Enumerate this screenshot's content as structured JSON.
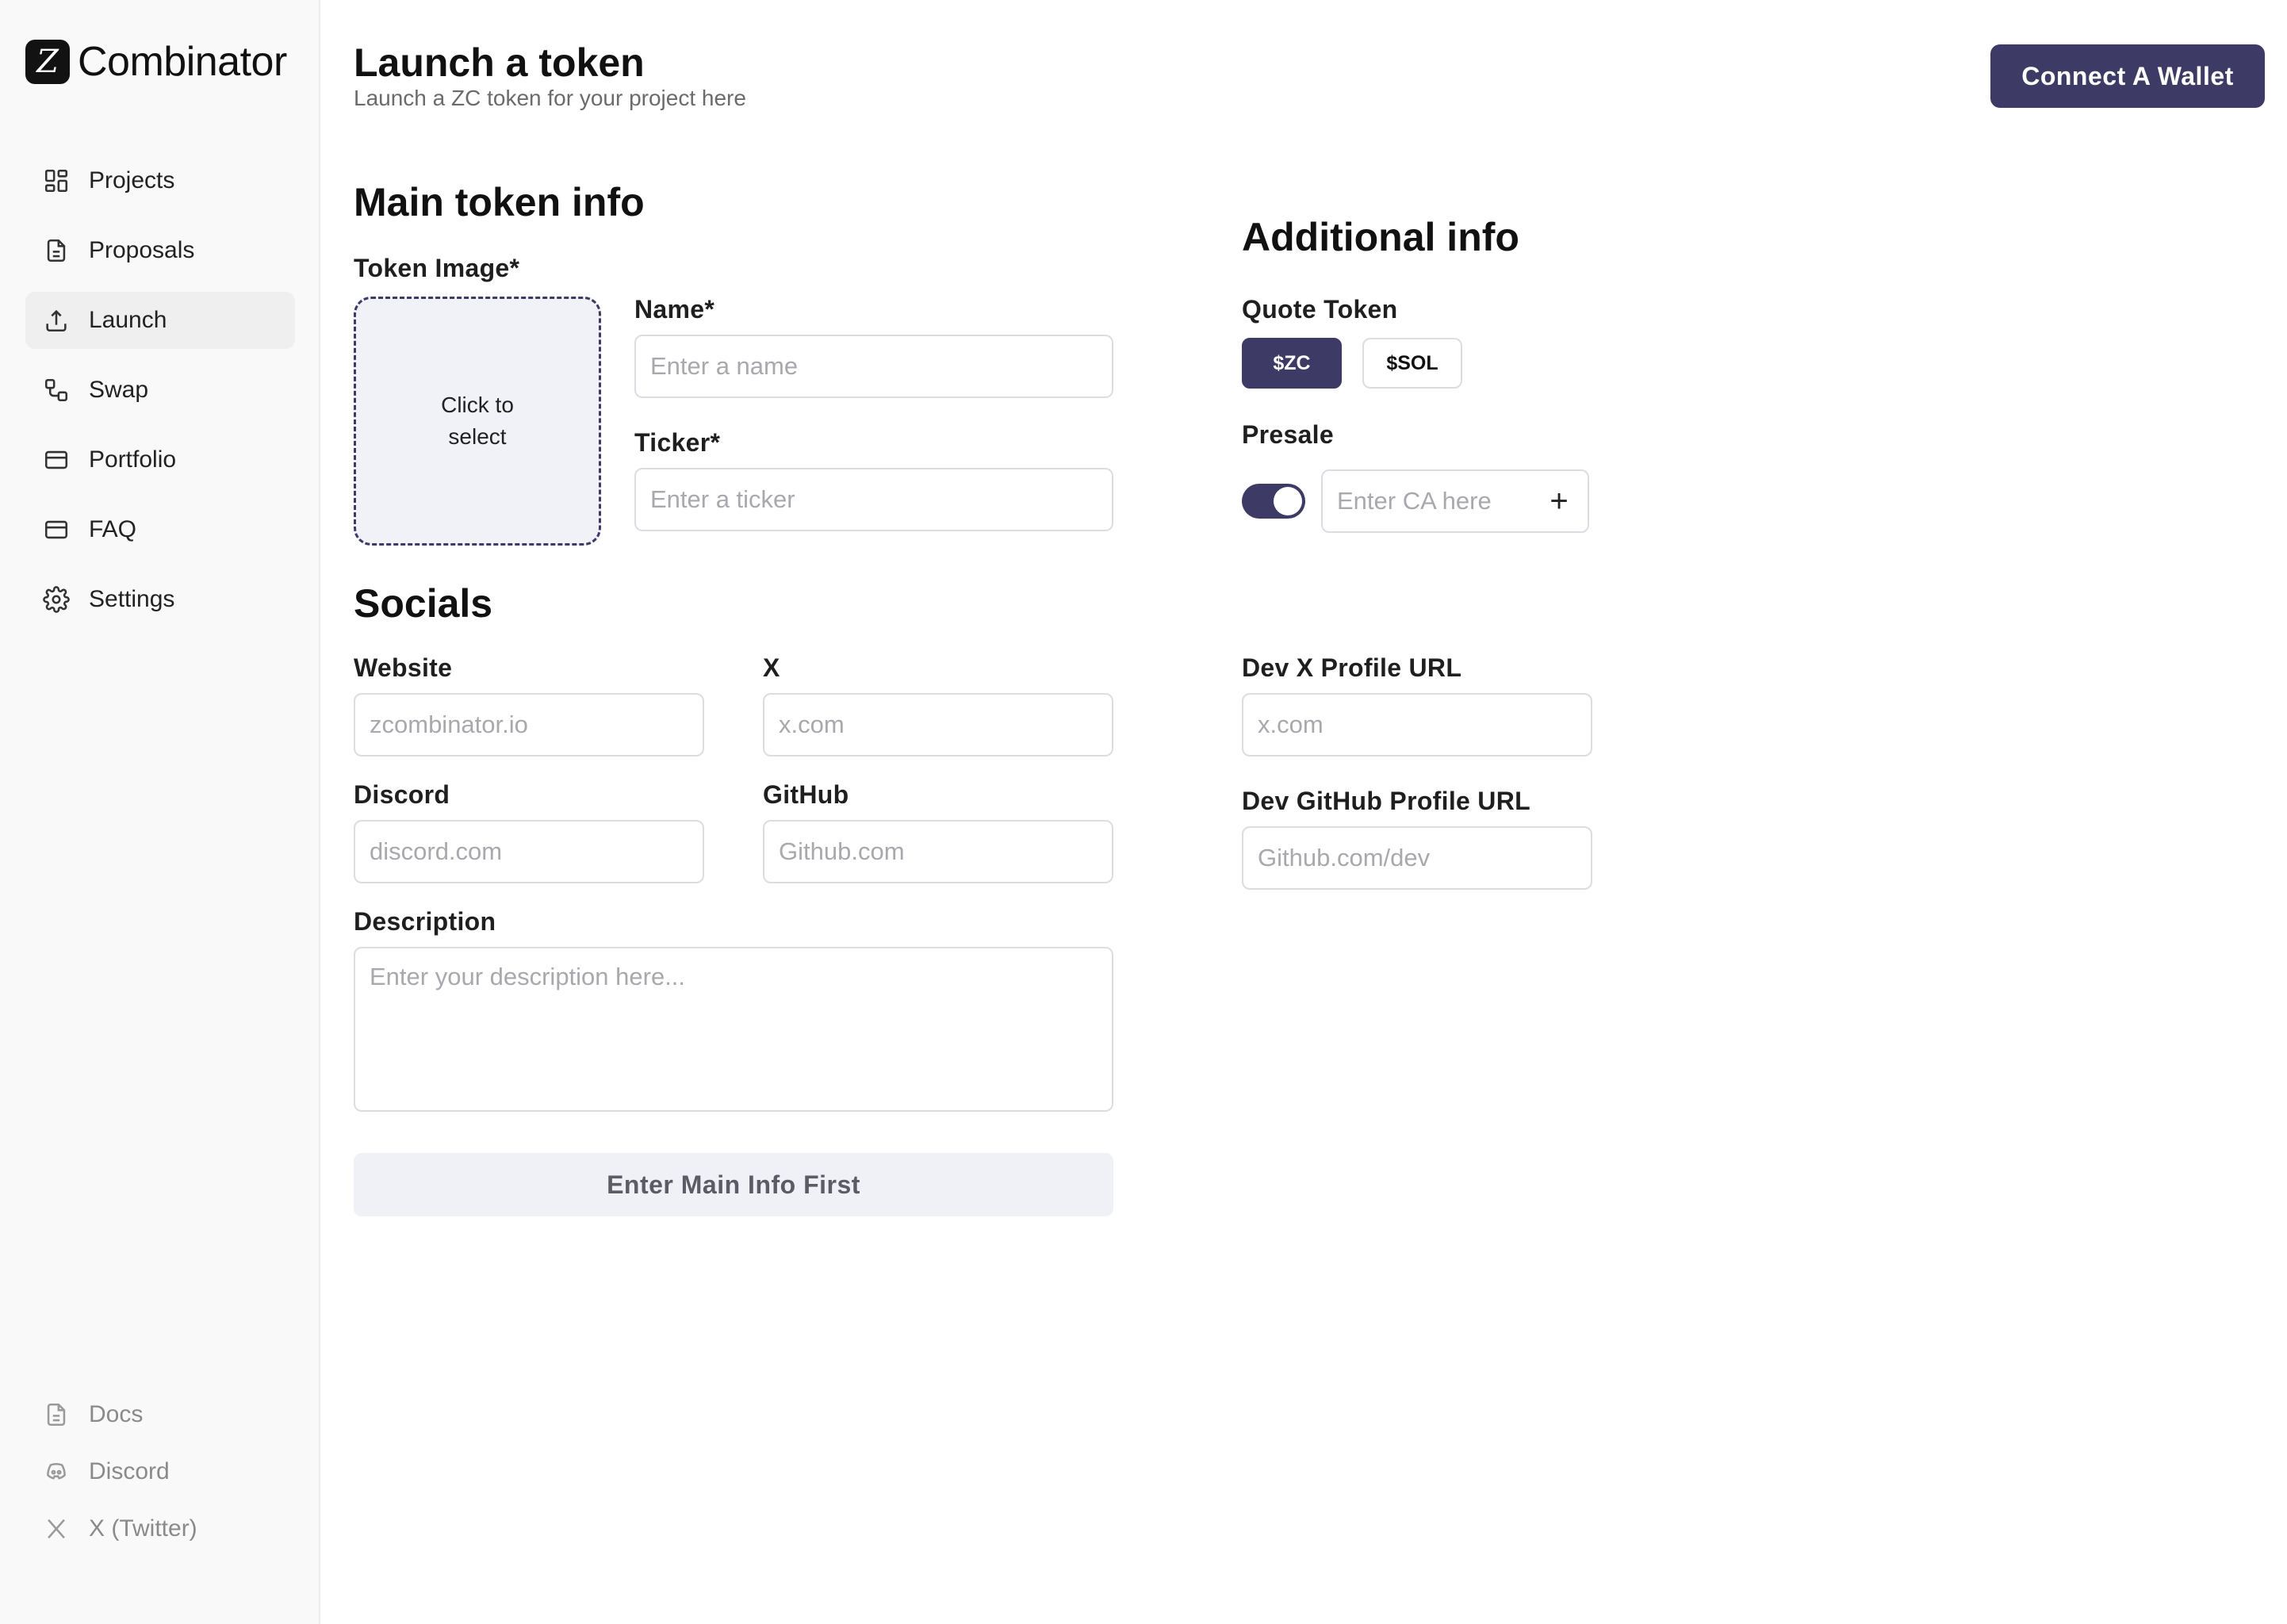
{
  "brand": {
    "logo_glyph": "Z",
    "name": "Combinator"
  },
  "nav": {
    "items": [
      {
        "label": "Projects",
        "icon": "grid-icon"
      },
      {
        "label": "Proposals",
        "icon": "document-icon"
      },
      {
        "label": "Launch",
        "icon": "upload-icon",
        "active": true
      },
      {
        "label": "Swap",
        "icon": "swap-icon"
      },
      {
        "label": "Portfolio",
        "icon": "wallet-card-icon"
      },
      {
        "label": "FAQ",
        "icon": "card-icon"
      },
      {
        "label": "Settings",
        "icon": "gear-icon"
      }
    ]
  },
  "footer_links": [
    {
      "label": "Docs",
      "icon": "document-icon"
    },
    {
      "label": "Discord",
      "icon": "discord-icon"
    },
    {
      "label": "X (Twitter)",
      "icon": "x-logo-icon"
    }
  ],
  "header": {
    "title": "Launch a token",
    "subtitle": "Launch a ZC token for your project here",
    "wallet_button": "Connect A Wallet"
  },
  "main_info": {
    "title": "Main token info",
    "image_label": "Token Image*",
    "image_prompt": "Click to select",
    "name_label": "Name*",
    "name_placeholder": "Enter a name",
    "ticker_label": "Ticker*",
    "ticker_placeholder": "Enter a ticker"
  },
  "additional": {
    "title": "Additional info",
    "quote_label": "Quote Token",
    "quote_options": [
      "$ZC",
      "$SOL"
    ],
    "quote_selected": "$ZC",
    "presale_label": "Presale",
    "presale_enabled": true,
    "ca_placeholder": "Enter CA here",
    "add_glyph": "+"
  },
  "socials": {
    "title": "Socials",
    "website_label": "Website",
    "website_placeholder": "zcombinator.io",
    "x_label": "X",
    "x_placeholder": "x.com",
    "discord_label": "Discord",
    "discord_placeholder": "discord.com",
    "github_label": "GitHub",
    "github_placeholder": "Github.com",
    "description_label": "Description",
    "description_placeholder": "Enter your description here...",
    "dev_x_label": "Dev X Profile URL",
    "dev_x_placeholder": "x.com",
    "dev_github_label": "Dev GitHub Profile URL",
    "dev_github_placeholder": "Github.com/dev"
  },
  "submit_button": "Enter Main Info First",
  "colors": {
    "accent": "#3e3a66",
    "sidebar_bg": "#f9f9f9",
    "muted_button_bg": "#f0f1f6"
  }
}
